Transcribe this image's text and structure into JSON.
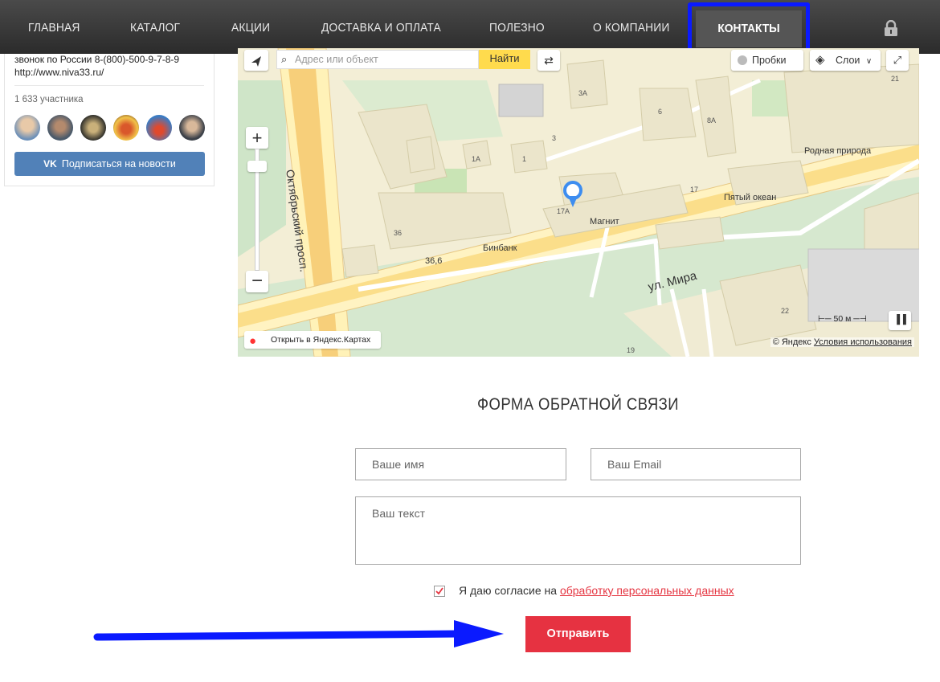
{
  "nav": {
    "items": [
      "ГЛАВНАЯ",
      "КАТАЛОГ",
      "АКЦИИ",
      "ДОСТАВКА И ОПЛАТА",
      "ПОЛЕЗНО",
      "О КОМПАНИИ"
    ],
    "active": "КОНТАКТЫ"
  },
  "vk": {
    "phone": "звонок по России 8-(800)-500-9-7-8-9",
    "site": "http://www.niva33.ru/",
    "members": "1 633 участника",
    "subscribe": "Подписаться на новости"
  },
  "map": {
    "search_placeholder": "Адрес или объект",
    "find_button": "Найти",
    "traffic": "Пробки",
    "layers": "Слои",
    "open_in_maps": "Открыть в Яндекс.Картах",
    "copyright": "© Яндекс",
    "terms": "Условия использования",
    "scale": "50 м",
    "labels": {
      "street1": "Октябрьский просп.",
      "street2": "ул. Мира",
      "magnit": "Магнит",
      "binbank": "Бинбанк",
      "pyatiy": "Пятый океан",
      "rodnaya": "Родная природа",
      "pharmacy": "36,6"
    },
    "numbers": [
      "3А",
      "6",
      "8А",
      "1А",
      "1",
      "3",
      "17",
      "17А",
      "36",
      "22",
      "19",
      "21"
    ]
  },
  "form": {
    "title": "ФОРМА ОБРАТНОЙ СВЯЗИ",
    "name_placeholder": "Ваше имя",
    "email_placeholder": "Ваш Email",
    "text_placeholder": "Ваш текст",
    "consent_text": "Я даю согласие на ",
    "consent_link": "обработку персональных данных",
    "submit": "Отправить"
  },
  "colors": {
    "annotation": "#0a1aff",
    "submit": "#e63241",
    "vk_button": "#5181b8"
  }
}
